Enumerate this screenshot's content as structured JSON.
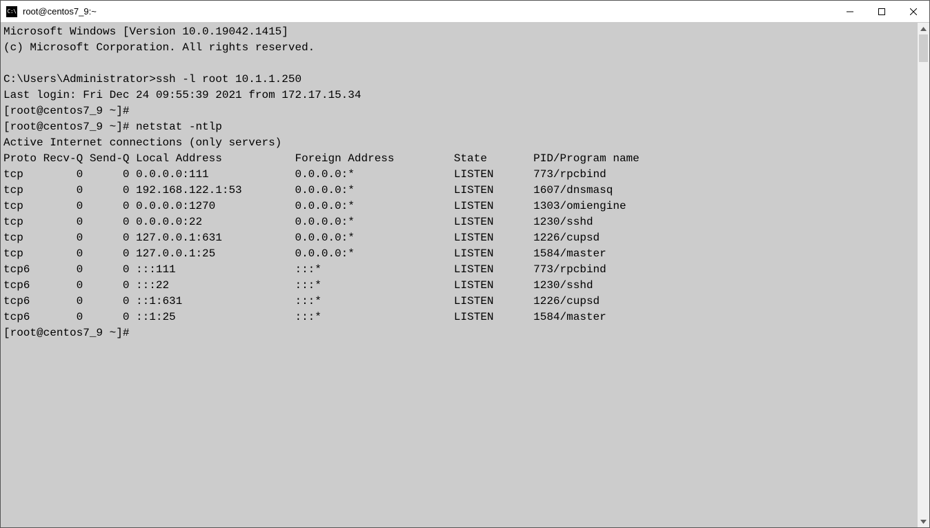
{
  "window": {
    "title": "root@centos7_9:~",
    "icon_label": "C:\\"
  },
  "terminal": {
    "lines": [
      "Microsoft Windows [Version 10.0.19042.1415]",
      "(c) Microsoft Corporation. All rights reserved.",
      "",
      "C:\\Users\\Administrator>ssh -l root 10.1.1.250",
      "Last login: Fri Dec 24 09:55:39 2021 from 172.17.15.34",
      "[root@centos7_9 ~]#",
      "[root@centos7_9 ~]# netstat -ntlp",
      "Active Internet connections (only servers)",
      "Proto Recv-Q Send-Q Local Address           Foreign Address         State       PID/Program name",
      "tcp        0      0 0.0.0.0:111             0.0.0.0:*               LISTEN      773/rpcbind",
      "tcp        0      0 192.168.122.1:53        0.0.0.0:*               LISTEN      1607/dnsmasq",
      "tcp        0      0 0.0.0.0:1270            0.0.0.0:*               LISTEN      1303/omiengine",
      "tcp        0      0 0.0.0.0:22              0.0.0.0:*               LISTEN      1230/sshd",
      "tcp        0      0 127.0.0.1:631           0.0.0.0:*               LISTEN      1226/cupsd",
      "tcp        0      0 127.0.0.1:25            0.0.0.0:*               LISTEN      1584/master",
      "tcp6       0      0 :::111                  :::*                    LISTEN      773/rpcbind",
      "tcp6       0      0 :::22                   :::*                    LISTEN      1230/sshd",
      "tcp6       0      0 ::1:631                 :::*                    LISTEN      1226/cupsd",
      "tcp6       0      0 ::1:25                  :::*                    LISTEN      1584/master",
      "[root@centos7_9 ~]#"
    ]
  }
}
